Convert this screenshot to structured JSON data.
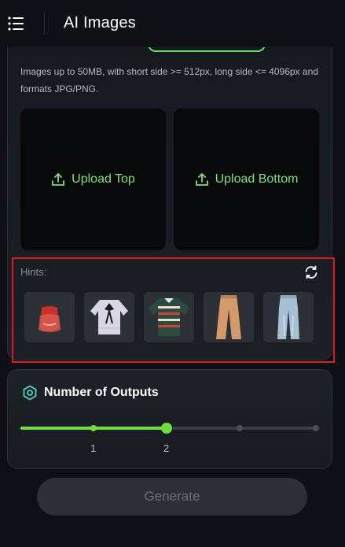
{
  "header": {
    "title": "AI Images",
    "menu_icon": "menu-icon"
  },
  "upload": {
    "info": "Images up to 50MB, with short side >= 512px, long side <= 4096px and formats JPG/PNG.",
    "top_label": "Upload Top",
    "bottom_label": "Upload Bottom",
    "icon": "upload-icon"
  },
  "hints": {
    "label": "Hints:",
    "refresh_icon": "refresh-icon",
    "items": [
      {
        "name": "red-fur-top"
      },
      {
        "name": "white-bow-blouse"
      },
      {
        "name": "striped-rugby-shirt"
      },
      {
        "name": "tan-flared-pants"
      },
      {
        "name": "light-wash-jeans"
      }
    ]
  },
  "outputs": {
    "title": "Number of Outputs",
    "icon": "hexagon-icon",
    "selected": 2,
    "level_fraction": 0.5,
    "ticks": [
      "1",
      "2"
    ]
  },
  "generate": {
    "label": "Generate"
  },
  "colors": {
    "accent": "#6fde3f",
    "upload_text": "#7ee077",
    "highlight": "#e01a1a"
  }
}
